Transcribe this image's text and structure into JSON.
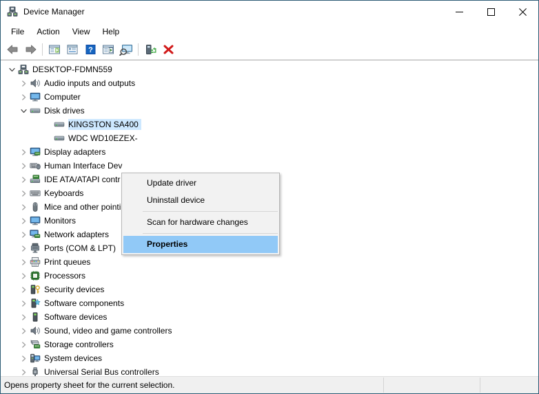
{
  "window": {
    "title": "Device Manager",
    "title_icon": "device-manager-icon",
    "caption": {
      "minimize": "minimize-icon",
      "maximize": "maximize-icon",
      "close": "close-icon"
    }
  },
  "menubar": {
    "items": [
      {
        "label": "File"
      },
      {
        "label": "Action"
      },
      {
        "label": "View"
      },
      {
        "label": "Help"
      }
    ]
  },
  "toolbar": {
    "buttons": [
      {
        "name": "back-arrow-icon",
        "tip": "Back"
      },
      {
        "name": "forward-arrow-icon",
        "tip": "Forward"
      },
      {
        "name": "separator-1",
        "tip": ""
      },
      {
        "name": "show-hide-console-tree-icon",
        "tip": "Show/Hide Console Tree"
      },
      {
        "name": "properties-icon",
        "tip": "Properties"
      },
      {
        "name": "help-icon",
        "tip": "Help"
      },
      {
        "name": "update-driver-icon",
        "tip": "Update Driver Software"
      },
      {
        "name": "scan-hardware-changes-icon",
        "tip": "Scan for hardware changes"
      },
      {
        "name": "separator-2",
        "tip": ""
      },
      {
        "name": "enable-device-icon",
        "tip": "Enable device"
      },
      {
        "name": "uninstall-device-icon",
        "tip": "Uninstall device"
      }
    ]
  },
  "tree": {
    "items": [
      {
        "label": "DESKTOP-FDMN559",
        "level": 0,
        "expander": "expanded",
        "icon": "computer-root-icon",
        "selected": false
      },
      {
        "label": "Audio inputs and outputs",
        "level": 1,
        "expander": "collapsed",
        "icon": "speaker-icon",
        "selected": false
      },
      {
        "label": "Computer",
        "level": 1,
        "expander": "collapsed",
        "icon": "monitor-icon",
        "selected": false
      },
      {
        "label": "Disk drives",
        "level": 1,
        "expander": "expanded",
        "icon": "disk-drive-icon",
        "selected": false
      },
      {
        "label": "KINGSTON SA400",
        "level": 2,
        "expander": "none",
        "icon": "disk-drive-icon",
        "selected": true
      },
      {
        "label": "WDC WD10EZEX-",
        "level": 2,
        "expander": "none",
        "icon": "disk-drive-icon",
        "selected": false
      },
      {
        "label": "Display adapters",
        "level": 1,
        "expander": "collapsed",
        "icon": "display-adapter-icon",
        "selected": false
      },
      {
        "label": "Human Interface Dev",
        "level": 1,
        "expander": "collapsed",
        "icon": "human-interface-icon",
        "selected": false
      },
      {
        "label": "IDE ATA/ATAPI contr",
        "level": 1,
        "expander": "collapsed",
        "icon": "ide-controller-icon",
        "selected": false
      },
      {
        "label": "Keyboards",
        "level": 1,
        "expander": "collapsed",
        "icon": "keyboard-icon",
        "selected": false
      },
      {
        "label": "Mice and other pointing devices",
        "level": 1,
        "expander": "collapsed",
        "icon": "mouse-icon",
        "selected": false
      },
      {
        "label": "Monitors",
        "level": 1,
        "expander": "collapsed",
        "icon": "monitor-icon",
        "selected": false
      },
      {
        "label": "Network adapters",
        "level": 1,
        "expander": "collapsed",
        "icon": "network-adapter-icon",
        "selected": false
      },
      {
        "label": "Ports (COM & LPT)",
        "level": 1,
        "expander": "collapsed",
        "icon": "port-icon",
        "selected": false
      },
      {
        "label": "Print queues",
        "level": 1,
        "expander": "collapsed",
        "icon": "printer-icon",
        "selected": false
      },
      {
        "label": "Processors",
        "level": 1,
        "expander": "collapsed",
        "icon": "processor-icon",
        "selected": false
      },
      {
        "label": "Security devices",
        "level": 1,
        "expander": "collapsed",
        "icon": "security-device-icon",
        "selected": false
      },
      {
        "label": "Software components",
        "level": 1,
        "expander": "collapsed",
        "icon": "software-component-icon",
        "selected": false
      },
      {
        "label": "Software devices",
        "level": 1,
        "expander": "collapsed",
        "icon": "software-device-icon",
        "selected": false
      },
      {
        "label": "Sound, video and game controllers",
        "level": 1,
        "expander": "collapsed",
        "icon": "speaker-icon",
        "selected": false
      },
      {
        "label": "Storage controllers",
        "level": 1,
        "expander": "collapsed",
        "icon": "storage-controller-icon",
        "selected": false
      },
      {
        "label": "System devices",
        "level": 1,
        "expander": "collapsed",
        "icon": "system-device-icon",
        "selected": false
      },
      {
        "label": "Universal Serial Bus controllers",
        "level": 1,
        "expander": "collapsed",
        "icon": "usb-icon",
        "selected": false
      }
    ]
  },
  "context_menu": {
    "items": [
      {
        "label": "Update driver",
        "type": "item",
        "highlighted": false
      },
      {
        "label": "Uninstall device",
        "type": "item",
        "highlighted": false
      },
      {
        "label": "",
        "type": "separator",
        "highlighted": false
      },
      {
        "label": "Scan for hardware changes",
        "type": "item",
        "highlighted": false
      },
      {
        "label": "",
        "type": "separator",
        "highlighted": false
      },
      {
        "label": "Properties",
        "type": "item",
        "highlighted": true
      }
    ]
  },
  "statusbar": {
    "message": "Opens property sheet for the current selection.",
    "pane2": "",
    "pane3": ""
  },
  "colors": {
    "window_border": "#2b5a74",
    "selection_blue": "#cde8ff",
    "menu_highlight": "#91c9f7",
    "menu_background": "#f2f2f2",
    "statusbar_background": "#f0f0f0"
  }
}
